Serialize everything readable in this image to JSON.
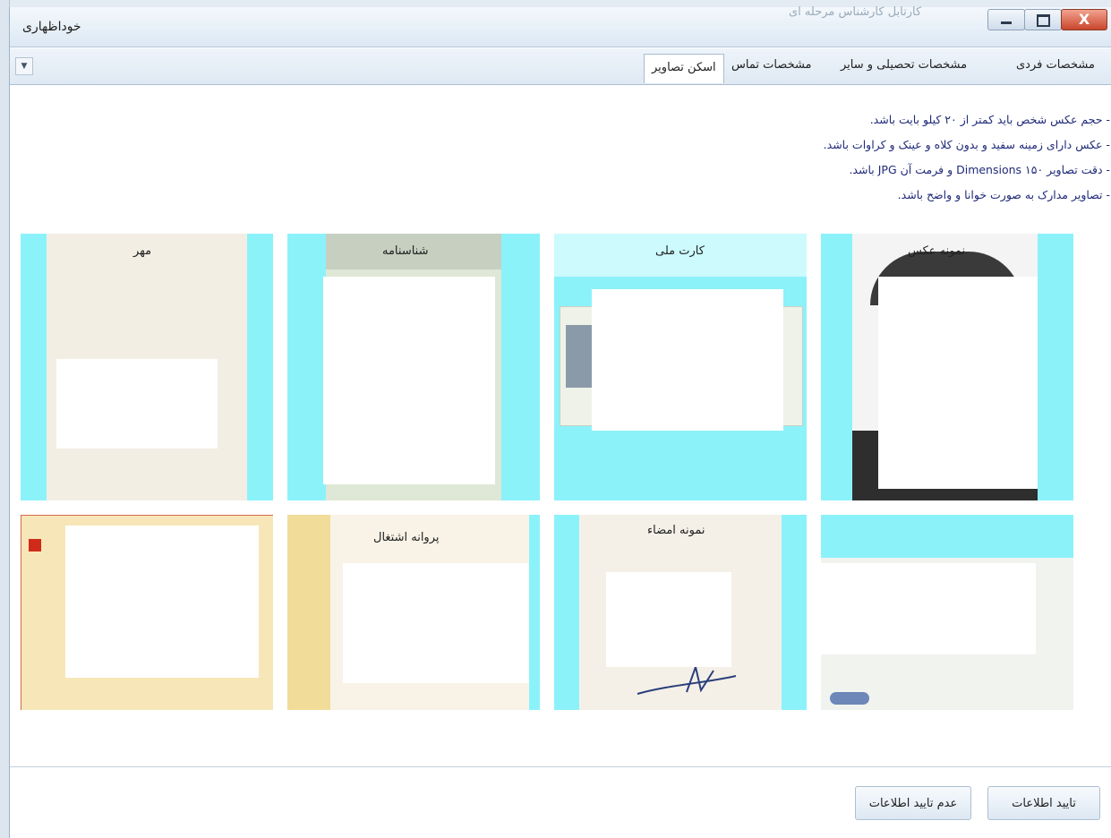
{
  "window": {
    "title": "خوداظهاری",
    "background_title": "کارتابل کارشناس مرحله ای",
    "close_glyph": "X",
    "dropdown_glyph": "▼"
  },
  "tabs": [
    {
      "label": "مشخصات فردی",
      "active": false
    },
    {
      "label": "مشخصات تحصیلی و سایر",
      "active": false
    },
    {
      "label": "مشخصات تماس",
      "active": false
    },
    {
      "label": "اسکن تصاویر",
      "active": true
    }
  ],
  "instructions": [
    "- حجم عکس شخص باید کمتر از ۲۰ کیلو بایت باشد.",
    "- عکس دارای زمینه سفید و بدون کلاه و عینک و کراوات باشد.",
    "- دقت تصاویر ۱۵۰ Dimensions و فرمت آن JPG باشد.",
    "- تصاویر مدارک به صورت خوانا و واضح باشد."
  ],
  "images": [
    {
      "label": "نمونه عکس"
    },
    {
      "label": "کارت ملی"
    },
    {
      "label": "شناسنامه"
    },
    {
      "label": "مهر"
    },
    {
      "label": ""
    },
    {
      "label": "نمونه امضاء"
    },
    {
      "label": "پروانه اشتغال"
    },
    {
      "label": ""
    }
  ],
  "actions": {
    "confirm": "تایید اطلاعات",
    "reject": "عدم تایید اطلاعات"
  },
  "colors": {
    "tile": "#8cf2fa",
    "instruction_text": "#1f2a7a",
    "close_button": "#c9462c"
  }
}
